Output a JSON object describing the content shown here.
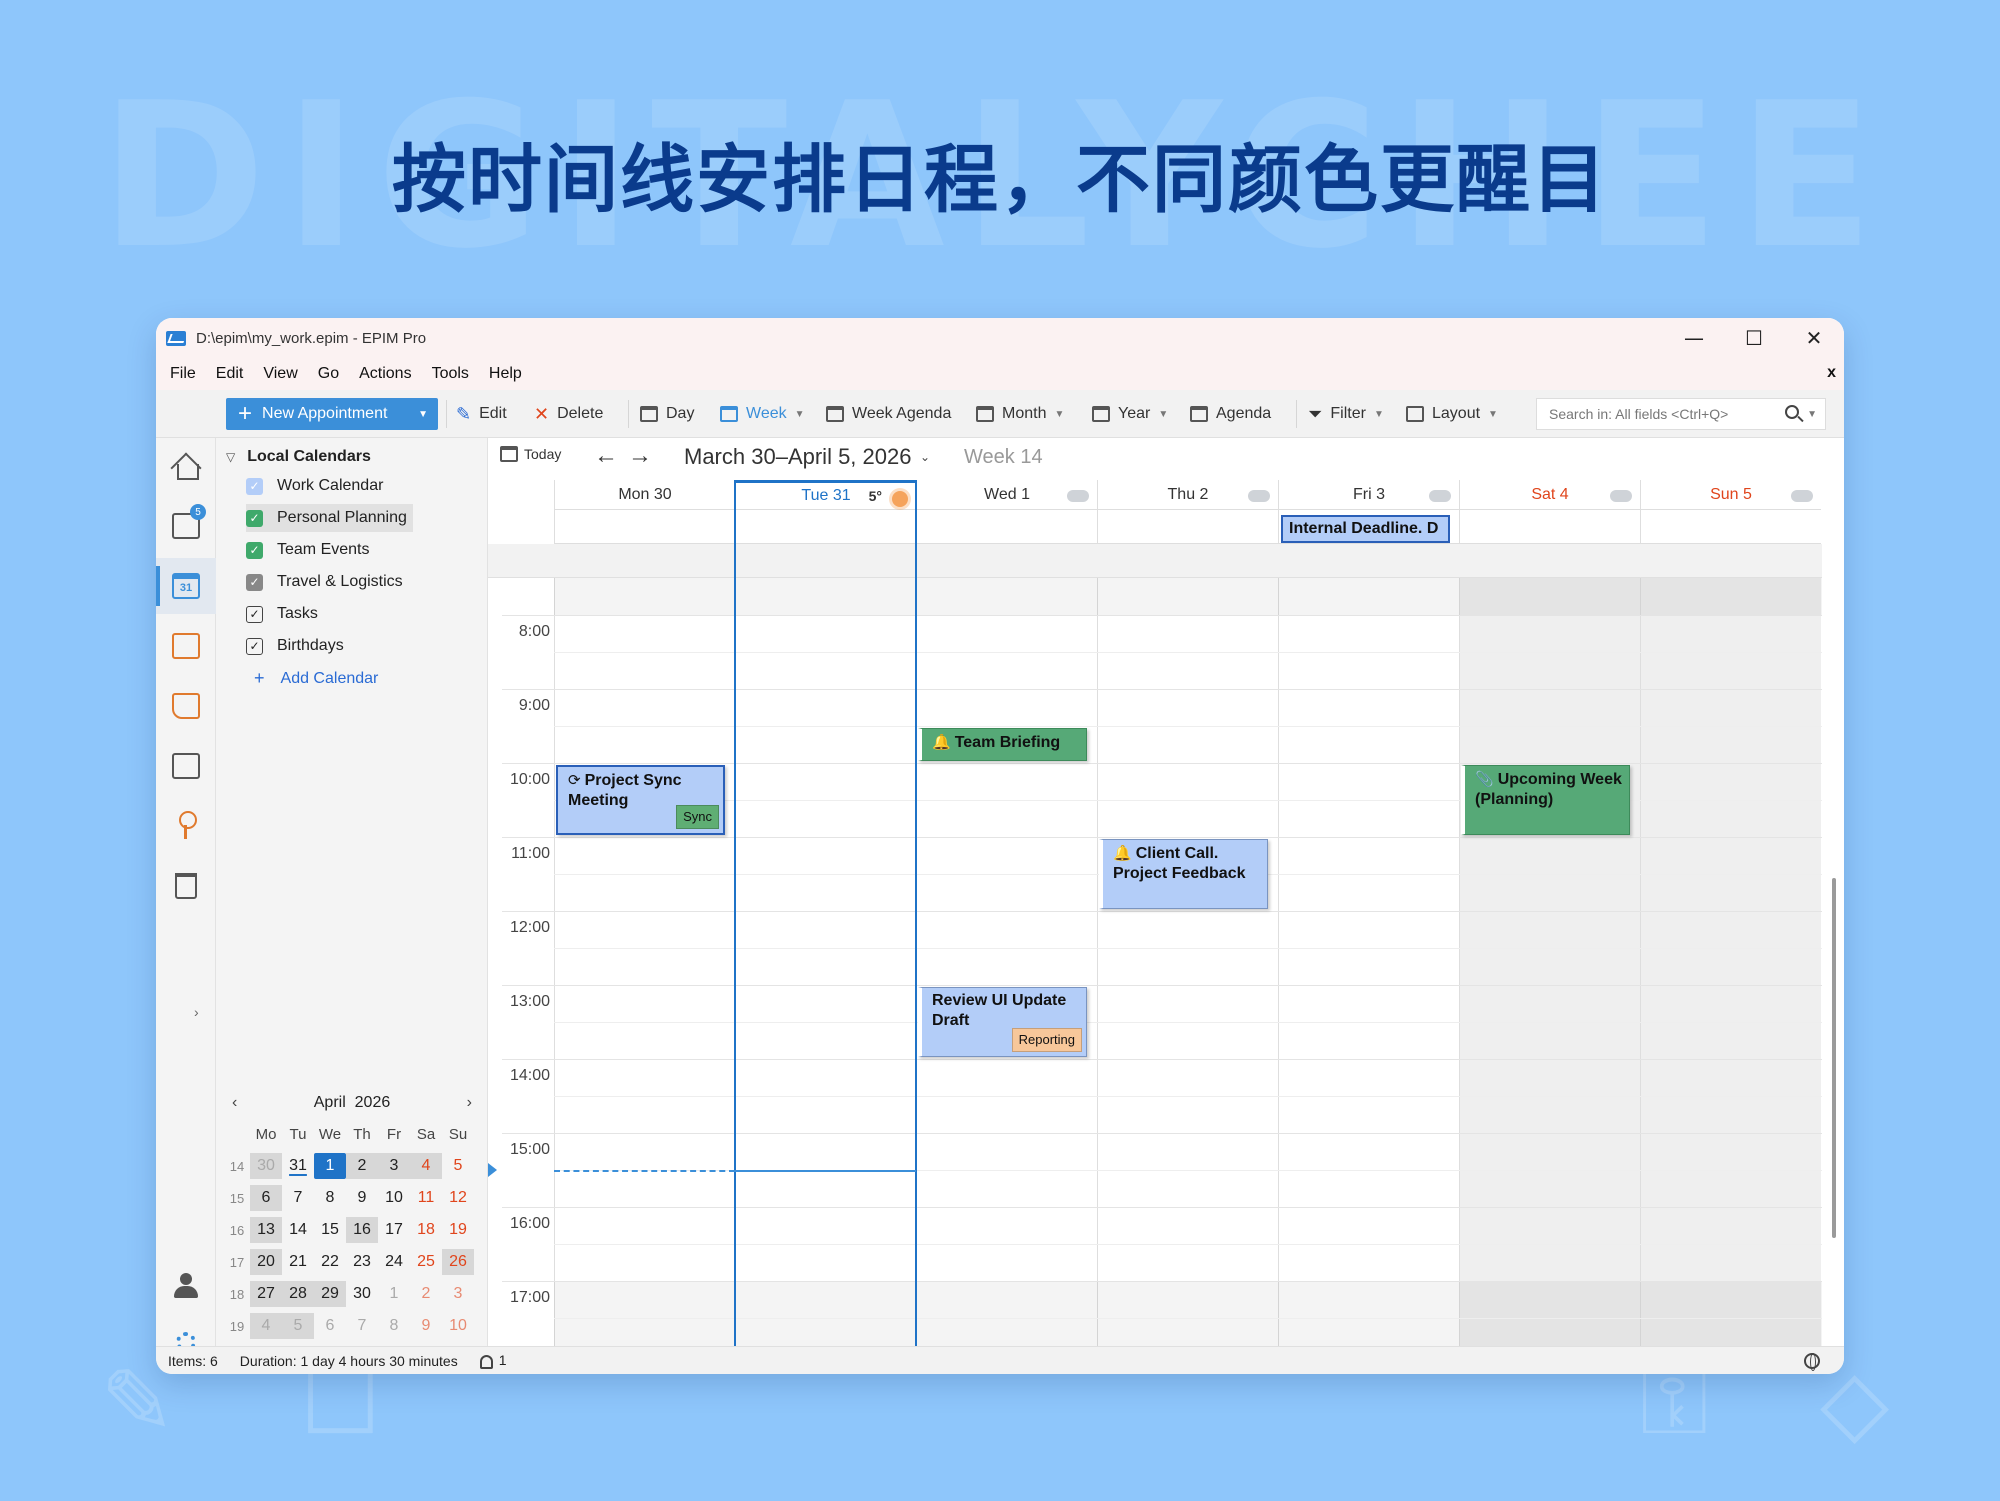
{
  "banner": {
    "watermark": "DIGITALYCHEE",
    "headline": "按时间线安排日程，不同颜色更醒目"
  },
  "window": {
    "title": "D:\\epim\\my_work.epim - EPIM Pro",
    "controls": {
      "minimize": "—",
      "maximize": "☐",
      "close": "✕"
    }
  },
  "menu": {
    "items": [
      "File",
      "Edit",
      "View",
      "Go",
      "Actions",
      "Tools",
      "Help"
    ],
    "close": "x"
  },
  "toolbar": {
    "new_appointment": "New Appointment",
    "edit": "Edit",
    "delete": "Delete",
    "day": "Day",
    "week": "Week",
    "week_agenda": "Week Agenda",
    "month": "Month",
    "year": "Year",
    "agenda": "Agenda",
    "filter": "Filter",
    "layout": "Layout",
    "search_placeholder": "Search in: All fields  <Ctrl+Q>"
  },
  "nav_rail": {
    "items": [
      "home-icon",
      "mail-icon",
      "calendar-icon",
      "tasks-icon",
      "notes-icon",
      "contacts-icon",
      "passwords-icon",
      "trash-icon"
    ],
    "mail_badge": "5",
    "calendar_day": "31",
    "bottom": [
      "user-icon",
      "settings-icon"
    ]
  },
  "calendars": {
    "header": "Local Calendars",
    "items": [
      {
        "label": "Work Calendar",
        "checked": true,
        "color": "#b3cdf8"
      },
      {
        "label": "Personal Planning",
        "checked": true,
        "color": "#3fa96b"
      },
      {
        "label": "Team Events",
        "checked": true,
        "color": "#3fa96b"
      },
      {
        "label": "Travel & Logistics",
        "checked": true,
        "color": "#888888"
      },
      {
        "label": "Tasks",
        "checked": true,
        "color": "#ffffff"
      },
      {
        "label": "Birthdays",
        "checked": true,
        "color": "#ffffff"
      }
    ],
    "add_label": "Add Calendar"
  },
  "mini_calendar": {
    "month": "April",
    "year": "2026",
    "weekdays": [
      "Mo",
      "Tu",
      "We",
      "Th",
      "Fr",
      "Sa",
      "Su"
    ],
    "weeks": [
      {
        "num": "14",
        "days": [
          "30",
          "31",
          "1",
          "2",
          "3",
          "4",
          "5"
        ]
      },
      {
        "num": "15",
        "days": [
          "6",
          "7",
          "8",
          "9",
          "10",
          "11",
          "12"
        ]
      },
      {
        "num": "16",
        "days": [
          "13",
          "14",
          "15",
          "16",
          "17",
          "18",
          "19"
        ]
      },
      {
        "num": "17",
        "days": [
          "20",
          "21",
          "22",
          "23",
          "24",
          "25",
          "26"
        ]
      },
      {
        "num": "18",
        "days": [
          "27",
          "28",
          "29",
          "30",
          "1",
          "2",
          "3"
        ]
      },
      {
        "num": "19",
        "days": [
          "4",
          "5",
          "6",
          "7",
          "8",
          "9",
          "10"
        ]
      }
    ]
  },
  "calendar": {
    "today_label": "Today",
    "range": "March 30–April 5, 2026",
    "week": "Week 14",
    "days": [
      {
        "label": "Mon 30",
        "weather": ""
      },
      {
        "label": "Tue 31",
        "weather": "sun",
        "temp": "5°"
      },
      {
        "label": "Wed 1",
        "weather": "cloud-sun"
      },
      {
        "label": "Thu 2",
        "weather": "cloud"
      },
      {
        "label": "Fri 3",
        "weather": "cloud"
      },
      {
        "label": "Sat 4",
        "weather": "cloud-sun"
      },
      {
        "label": "Sun 5",
        "weather": "cloud"
      }
    ],
    "hours": [
      "8:00",
      "9:00",
      "10:00",
      "11:00",
      "12:00",
      "13:00",
      "14:00",
      "15:00",
      "16:00",
      "17:00"
    ],
    "allday_events": [
      {
        "title": "Internal Deadline. D",
        "day": 4
      }
    ],
    "events": [
      {
        "title": "Project Sync Meeting",
        "day": 0,
        "start": 10.0,
        "end": 11.0,
        "style": "blue",
        "icon": "⟳",
        "tag": "Sync",
        "tag_color": "#5fae74"
      },
      {
        "title": "Team Briefing",
        "day": 2,
        "start": 9.5,
        "end": 10.0,
        "style": "green",
        "icon": "🔔"
      },
      {
        "title": "Upcoming Week (Planning)",
        "day": 5,
        "start": 10.0,
        "end": 11.0,
        "style": "green",
        "icon": "📎"
      },
      {
        "title": "Client Call. Project Feedback",
        "day": 3,
        "start": 11.0,
        "end": 12.0,
        "style": "bluelight",
        "icon": "🔔"
      },
      {
        "title": "Review UI Update Draft",
        "day": 2,
        "start": 13.0,
        "end": 14.0,
        "style": "bluelight",
        "tag": "Reporting",
        "tag_color": "#f7c79a"
      }
    ],
    "now_time": 15.5
  },
  "status": {
    "items": "Items: 6",
    "duration": "Duration: 1 day 4 hours 30 minutes",
    "reminders": "1"
  }
}
